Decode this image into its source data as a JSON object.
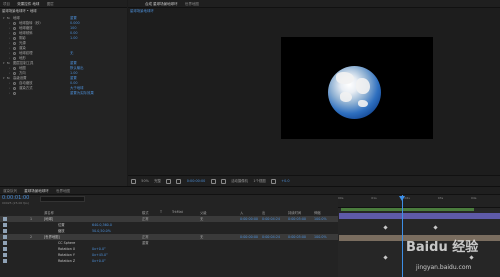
{
  "effect_controls": {
    "tabs": [
      "项目",
      "效果控件 地球",
      "图层"
    ],
    "header": "星球场景地球环 • 地球",
    "effect_name": "地球",
    "reset_label": "重置",
    "rows": [
      {
        "label": "地球",
        "value": "重置",
        "indent": 0
      },
      {
        "label": "地球旋转（秒）",
        "value": "0.000",
        "indent": 2
      },
      {
        "label": "地球缩放",
        "value": "100",
        "indent": 2
      },
      {
        "label": "地球倾斜",
        "value": "0.00",
        "indent": 2
      },
      {
        "label": "阴影",
        "value": "1.00",
        "indent": 2
      },
      {
        "label": "光源",
        "value": "",
        "indent": 2
      },
      {
        "label": "渲染",
        "value": "",
        "indent": 2
      },
      {
        "label": "地球纹理",
        "value": "无",
        "indent": 2
      },
      {
        "label": "地形",
        "value": "",
        "indent": 2
      },
      {
        "label": "图层控制工具",
        "value": "重置",
        "indent": 0
      },
      {
        "label": "地图",
        "value": "默认输出",
        "indent": 2
      },
      {
        "label": "方向",
        "value": "1.00",
        "indent": 2
      },
      {
        "label": "高级设置",
        "value": "重置",
        "indent": 0
      },
      {
        "label": "自动缩放",
        "value": "0.00",
        "indent": 2
      },
      {
        "label": "渲染方式",
        "value": "大于地球",
        "indent": 2
      },
      {
        "label": "",
        "value": "重置为实际效果",
        "indent": 2
      }
    ]
  },
  "viewer": {
    "tabs": [
      "合成 星球场景地球环",
      "世界地图"
    ],
    "active_tab": "星球场景地球环",
    "toolbar": [
      "50%",
      "完整",
      "0:00:00:00",
      "活动摄像机",
      "1个视图",
      "+0.0"
    ]
  },
  "timeline": {
    "tabs": [
      "渲染队列",
      "星球场景地球环",
      "世界地图"
    ],
    "timecode": "0:00:01:00",
    "frame_info": "00025 (25.00 fps)",
    "columns": [
      "源名称",
      "模式",
      "T",
      "TrkMat",
      "父级",
      "入",
      "出",
      "持续时间",
      "伸缩"
    ],
    "ruler_ticks": [
      "00s",
      "01s",
      "02s",
      "03s",
      "04s"
    ],
    "layers": [
      {
        "num": "1",
        "name": "[地球]",
        "mode": "正常",
        "parent": "无",
        "in": "0:00:00:00",
        "out": "0:00:04:24",
        "dur": "0:00:05:00",
        "stretch": "100.0%"
      },
      {
        "num": "",
        "name": "位置",
        "mode": "",
        "parent": "",
        "in": "",
        "out": "",
        "dur": "",
        "stretch": "",
        "value": "640.0,360.0"
      },
      {
        "num": "",
        "name": "缩放",
        "mode": "",
        "parent": "",
        "in": "",
        "out": "",
        "dur": "",
        "stretch": "",
        "value": "50.0,50.0%"
      },
      {
        "num": "2",
        "name": "[世界地图]",
        "mode": "正常",
        "parent": "无",
        "in": "0:00:00:00",
        "out": "0:00:04:24",
        "dur": "0:00:05:00",
        "stretch": "100.0%"
      },
      {
        "num": "",
        "name": "CC Sphere",
        "mode": "重置",
        "parent": "",
        "in": "",
        "out": "",
        "dur": "",
        "stretch": ""
      },
      {
        "num": "",
        "name": "Rotation X",
        "mode": "",
        "parent": "",
        "in": "",
        "out": "",
        "dur": "",
        "stretch": "",
        "value": "0x+0.0°"
      },
      {
        "num": "",
        "name": "Rotation Y",
        "mode": "",
        "parent": "",
        "in": "",
        "out": "",
        "dur": "",
        "stretch": "",
        "value": "0x+45.0°"
      },
      {
        "num": "",
        "name": "Rotation Z",
        "mode": "",
        "parent": "",
        "in": "",
        "out": "",
        "dur": "",
        "stretch": "",
        "value": "0x+0.0°"
      }
    ]
  },
  "watermark": {
    "brand": "Baidu 经验",
    "url": "jingyan.baidu.com"
  },
  "colors": {
    "accent_blue": "#4c8fd8",
    "playhead": "#3d8ee6",
    "bar_purple": "#5e5aa8",
    "workarea_green": "#4a7c3d"
  }
}
